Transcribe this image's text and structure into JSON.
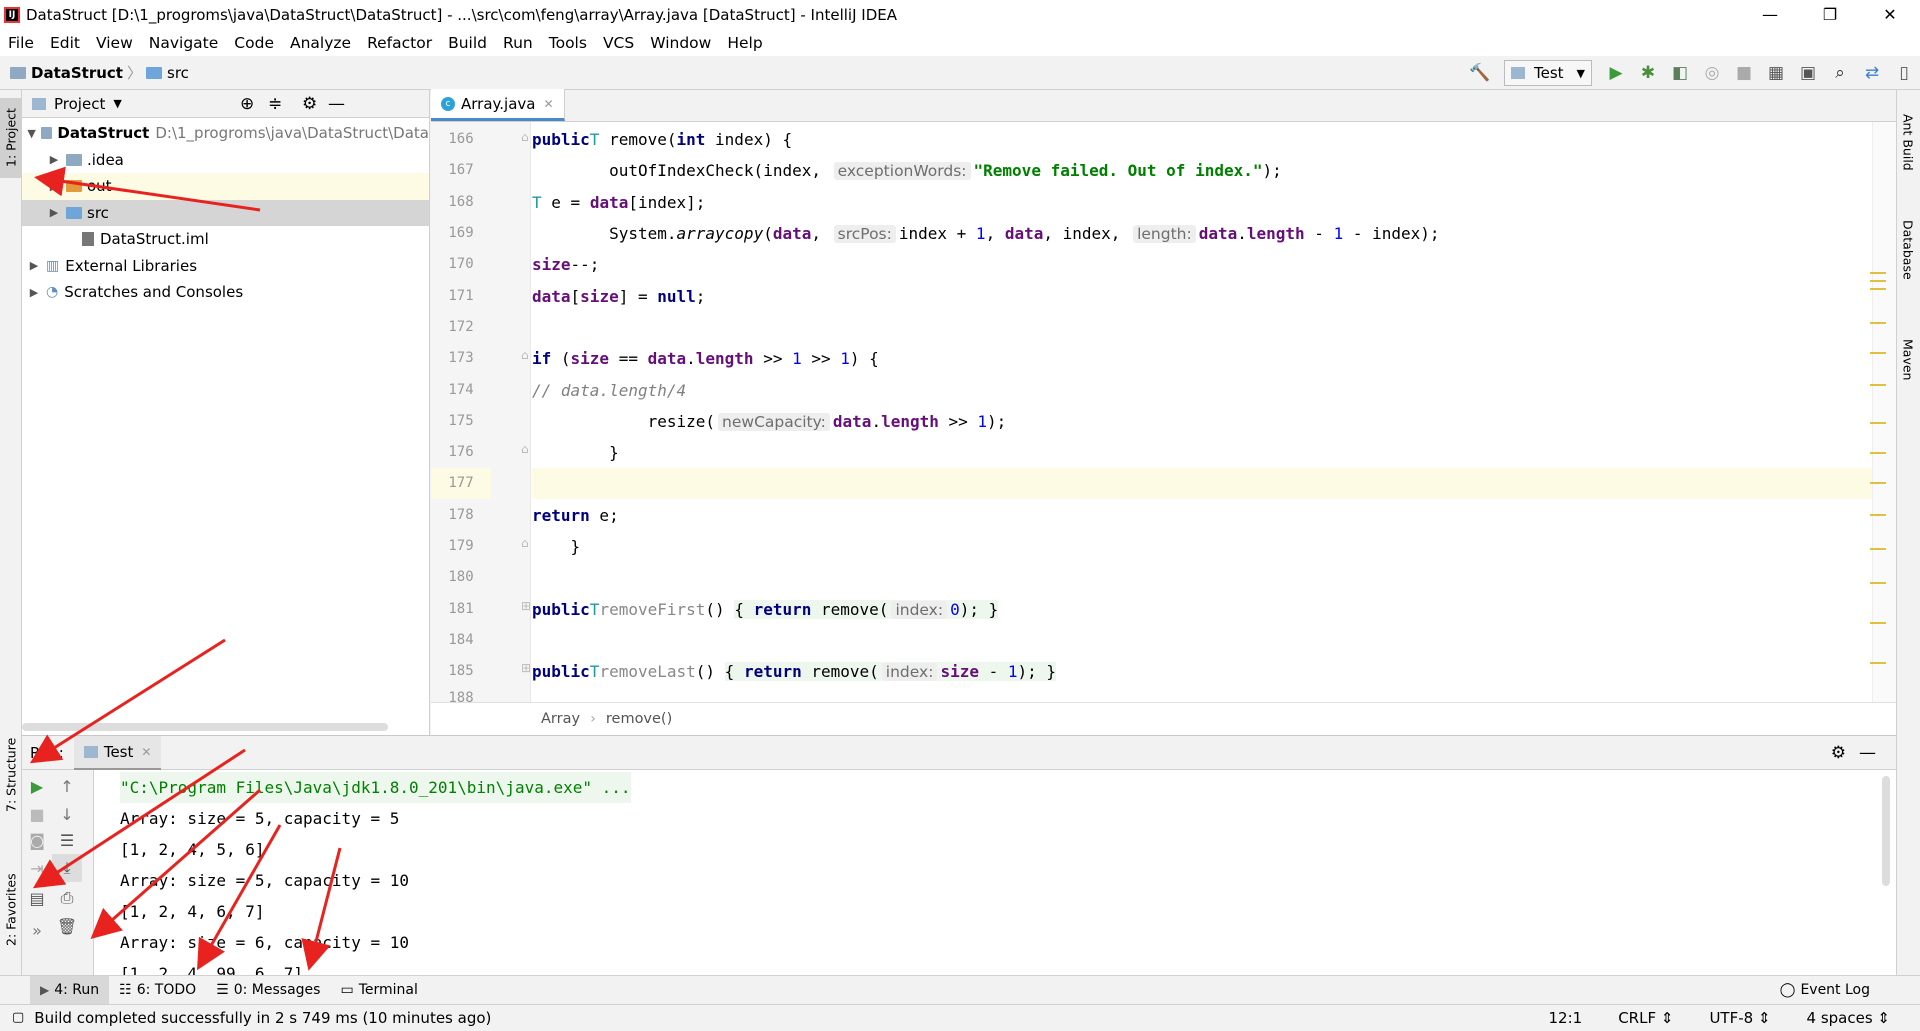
{
  "window": {
    "title": "DataStruct [D:\\1_progroms\\java\\DataStruct\\DataStruct] - ...\\src\\com\\feng\\array\\Array.java [DataStruct] - IntelliJ IDEA",
    "minimize": "—",
    "maximize": "❐",
    "close": "✕"
  },
  "menu": [
    "File",
    "Edit",
    "View",
    "Navigate",
    "Code",
    "Analyze",
    "Refactor",
    "Build",
    "Run",
    "Tools",
    "VCS",
    "Window",
    "Help"
  ],
  "nav": {
    "project": "DataStruct",
    "folder": "src",
    "run_config": "Test"
  },
  "left_stripe": {
    "project_tab": "1: Project",
    "structure_tab": "7: Structure",
    "favorites_tab": "2: Favorites"
  },
  "right_stripe": {
    "ant": "Ant Build",
    "database": "Database",
    "maven": "Maven"
  },
  "project_panel": {
    "title": "Project",
    "tree": [
      {
        "name": "DataStruct",
        "path": "D:\\1_progroms\\java\\DataStruct\\Data"
      },
      {
        "name": ".idea"
      },
      {
        "name": "out"
      },
      {
        "name": "src"
      },
      {
        "name": "DataStruct.iml"
      },
      {
        "name": "External Libraries"
      },
      {
        "name": "Scratches and Consoles"
      }
    ]
  },
  "editor": {
    "tab": "Array.java",
    "line_numbers": [
      "166",
      "167",
      "168",
      "169",
      "170",
      "171",
      "172",
      "173",
      "174",
      "175",
      "176",
      "177",
      "178",
      "179",
      "180",
      "181",
      "184",
      "185",
      "188"
    ],
    "breadcrumb": [
      "Array",
      "remove()"
    ]
  },
  "run_panel": {
    "label": "Run:",
    "tab": "Test",
    "console": [
      "\"C:\\Program Files\\Java\\jdk1.8.0_201\\bin\\java.exe\" ...",
      "Array: size = 5, capacity = 5",
      "[1, 2, 4, 5, 6]",
      "Array: size = 5, capacity = 10",
      "[1, 2, 4, 6, 7]",
      "Array: size = 6, capacity = 10",
      "[1, 2, 4, 99, 6, 7]"
    ]
  },
  "bottom_tabs": [
    "4: Run",
    "6: TODO",
    "0: Messages",
    "Terminal",
    "Event Log"
  ],
  "status": {
    "message": "Build completed successfully in 2 s 749 ms (10 minutes ago)",
    "position": "12:1",
    "line_sep": "CRLF",
    "encoding": "UTF-8",
    "indent": "4 spaces"
  },
  "colors": {
    "keyword": "#000080",
    "field": "#660e7a",
    "string": "#008000",
    "number": "#0000ff",
    "accent_arrow": "#e8231f"
  }
}
